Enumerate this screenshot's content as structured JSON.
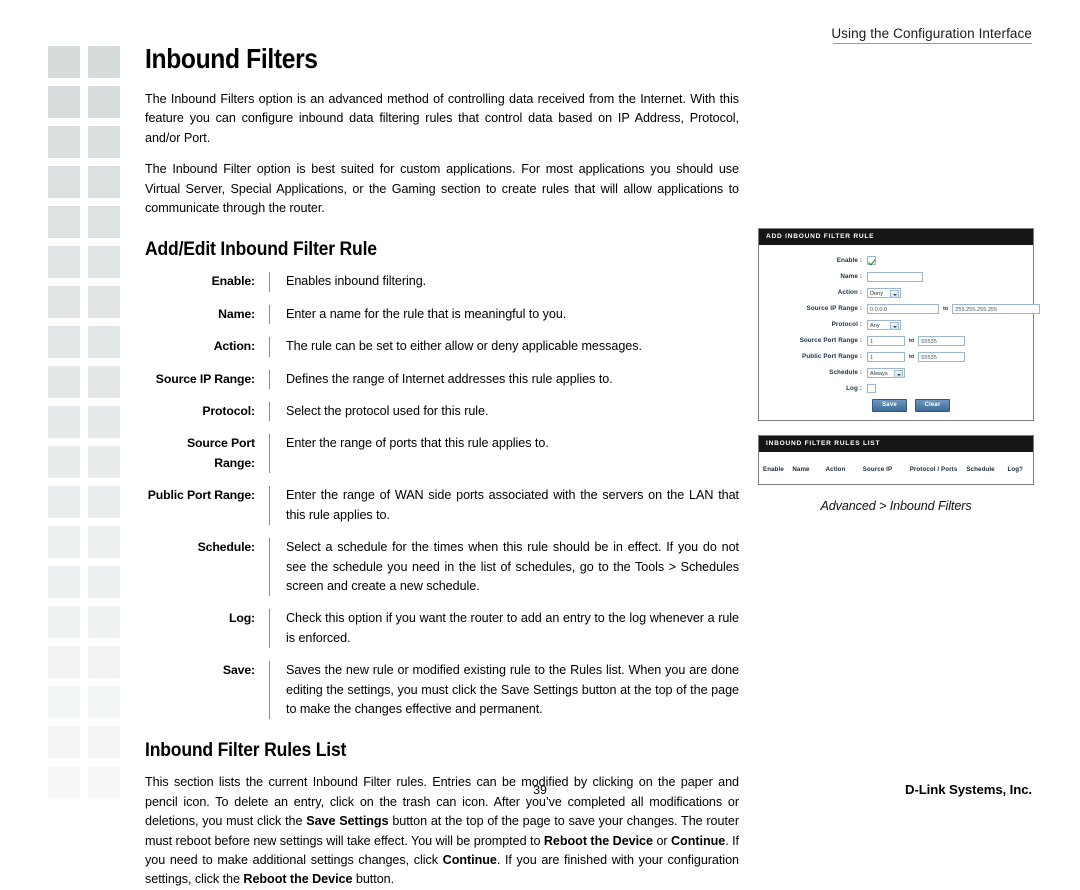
{
  "header": {
    "running_head": "Using the Configuration Interface"
  },
  "page": {
    "title": "Inbound Filters",
    "intro_paragraphs": [
      "The Inbound Filters option is an advanced method of controlling data received from the Internet. With this feature you can configure inbound data filtering rules that control data based on IP Address, Protocol, and/or Port.",
      "The Inbound Filter option is best suited for custom applications. For most applications you should use Virtual Server, Special Applications, or the Gaming section to create rules that will allow applications to communicate through the router."
    ]
  },
  "section_add_edit": {
    "title": "Add/Edit Inbound Filter Rule",
    "definitions": [
      {
        "term": "Enable:",
        "text": "Enables inbound filtering."
      },
      {
        "term": "Name:",
        "text": "Enter a name for the rule that is meaningful to you."
      },
      {
        "term": "Action:",
        "text": "The rule can be set to either allow or deny applicable messages."
      },
      {
        "term": "Source IP Range:",
        "text": "Defines the range of Internet addresses this rule applies to."
      },
      {
        "term": "Protocol:",
        "text": "Select the protocol used for this rule."
      },
      {
        "term": "Source Port Range:",
        "text": "Enter the range of ports that this rule applies to."
      },
      {
        "term": "Public Port Range:",
        "text": "Enter the range of WAN side ports associated with the servers on the LAN that this rule applies to."
      },
      {
        "term": "Schedule:",
        "text": "Select a schedule for the times when this rule should be in effect. If you do not see the schedule you need in the list of schedules, go to the Tools > Schedules screen and create a new schedule."
      },
      {
        "term": "Log:",
        "text": "Check this option if you want the router to add an entry to the log whenever a rule is enforced."
      },
      {
        "term": "Save:",
        "text": "Saves the new rule or modified existing rule to the Rules list. When you are done editing the settings, you must click the Save Settings button at the top of the page to make the changes effective and permanent."
      }
    ]
  },
  "section_rules_list": {
    "title": "Inbound Filter Rules List",
    "paragraph_runs": [
      {
        "text": "This section lists the current Inbound Filter rules. Entries can be modified by clicking on the paper and pencil icon. To delete an entry, click on the trash can icon. After you’ve completed all modifications or deletions, you must click the ",
        "bold": false
      },
      {
        "text": "Save Settings",
        "bold": true
      },
      {
        "text": " button at the top of the page to save your changes. The router must reboot before new settings will take effect. You will be prompted to ",
        "bold": false
      },
      {
        "text": "Reboot the Device",
        "bold": true
      },
      {
        "text": " or ",
        "bold": false
      },
      {
        "text": "Continue",
        "bold": true
      },
      {
        "text": ". If you need to make additional settings changes, click ",
        "bold": false
      },
      {
        "text": "Continue",
        "bold": true
      },
      {
        "text": ". If you are finished with your configuration settings, click the ",
        "bold": false
      },
      {
        "text": "Reboot the Device",
        "bold": true
      },
      {
        "text": " button.",
        "bold": false
      }
    ]
  },
  "screenshot_add_rule": {
    "panel_title": "ADD INBOUND FILTER RULE",
    "fields": {
      "enable": {
        "label": "Enable :",
        "checked": true
      },
      "name": {
        "label": "Name :",
        "value": ""
      },
      "action": {
        "label": "Action :",
        "value": "Deny"
      },
      "source_ip_range": {
        "label": "Source IP Range :",
        "from": "0.0.0.0",
        "to_label": "to",
        "to": "255.255.255.255"
      },
      "protocol": {
        "label": "Protocol :",
        "value": "Any"
      },
      "source_port_range": {
        "label": "Source Port Range :",
        "from": "1",
        "to_label": "to",
        "to": "65535"
      },
      "public_port_range": {
        "label": "Public Port Range :",
        "from": "1",
        "to_label": "to",
        "to": "65535"
      },
      "schedule": {
        "label": "Schedule :",
        "value": "Always"
      },
      "log": {
        "label": "Log :",
        "checked": false
      }
    },
    "buttons": {
      "save": "Save",
      "clear": "Clear"
    }
  },
  "screenshot_rules_list": {
    "panel_title": "INBOUND FILTER RULES LIST",
    "columns": [
      "Enable",
      "Name",
      "Action",
      "Source IP",
      "Protocol / Ports",
      "Schedule",
      "Log?"
    ]
  },
  "caption": "Advanced > Inbound Filters",
  "footer": {
    "page_number": "39",
    "brand": "D-Link Systems, Inc."
  },
  "colors": {
    "panel_title_bg": "#151515",
    "deco_box": "#d6dcdc",
    "field_border": "#9cb6cf",
    "button_blue": "#3c6c97",
    "label_blue": "#17324e"
  }
}
